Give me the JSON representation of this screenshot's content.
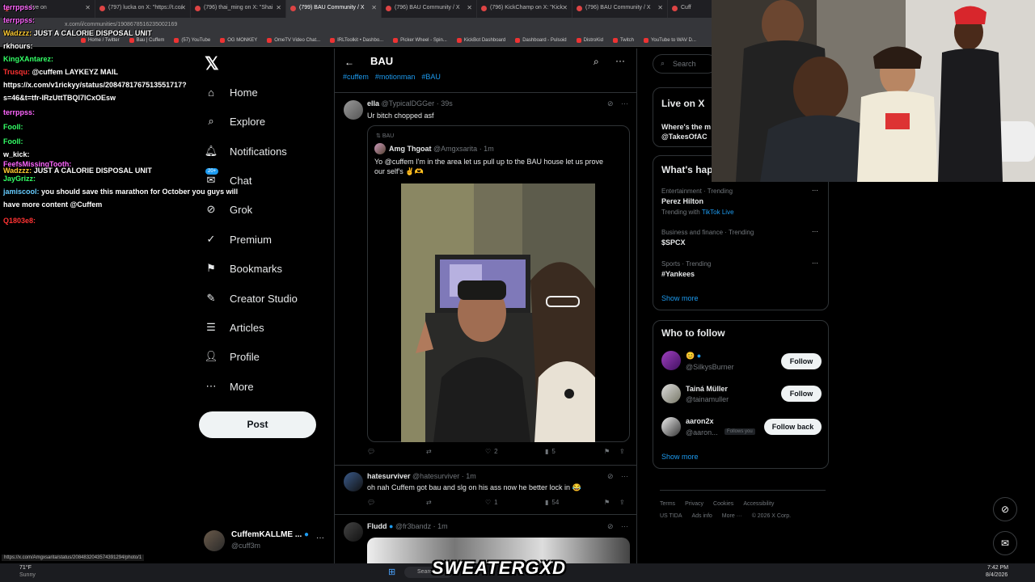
{
  "browser": {
    "tabs": [
      {
        "label": "Watch live on"
      },
      {
        "label": "(797) lucka on X: \"https://t.co/"
      },
      {
        "label": "(796) thai_ming on X: \"Shai"
      },
      {
        "label": "(799) BAU Community / X"
      },
      {
        "label": "(796) BAU Community / X"
      },
      {
        "label": "(796) KickChamp on X: \"Kick"
      },
      {
        "label": "(796) BAU Community / X"
      },
      {
        "label": "Cuff"
      }
    ],
    "url": "x.com/i/communities/1908678516235002169",
    "bookmarks": [
      "Home / Twitter",
      "Bau | Cuffem",
      "(57) YouTube",
      "OG MONKEY",
      "OmeTV Video Chat...",
      "IRLToolkit • Dashbo...",
      "Picker Wheel - Spin...",
      "KickBot Dashboard",
      "Dashboard - Pulsoid",
      "DistroKid",
      "Twitch",
      "YouTube to WAV D..."
    ]
  },
  "nav": {
    "items": [
      "Home",
      "Explore",
      "Notifications",
      "Chat",
      "Grok",
      "Premium",
      "Bookmarks",
      "Creator Studio",
      "Articles",
      "Profile",
      "More"
    ],
    "chat_badge": "20+",
    "post_label": "Post",
    "account_name": "CuffemKALLME ...",
    "account_handle": "@cuff3m"
  },
  "header": {
    "title": "BAU",
    "tags": [
      "#cuffem",
      "#motionman",
      "#BAU"
    ]
  },
  "tweets": [
    {
      "name": "ella",
      "handle": "@TypicalDGGer",
      "time": "· 39s",
      "text": "Ur bitch chopped asf",
      "quote": {
        "community": "BAU",
        "name": "Amg Thgoat",
        "handle": "@Amgxsarita",
        "time": "· 1m",
        "text_1": "Yo @cuffem I'm in the area let us pull up to the BAU house let us prove",
        "text_2": "our self's ✌️🫶"
      },
      "likes": "2",
      "views": "5"
    },
    {
      "name": "hatesurviver",
      "handle": "@hatesurviver",
      "time": "· 1m",
      "text": "oh nah Cuffem got bau and slg on his ass now he better lock in 😂",
      "likes": "1",
      "views": "54"
    },
    {
      "name": "Fludd",
      "handle": "@fr3bandz",
      "time": "· 1m"
    }
  ],
  "right": {
    "search_placeholder": "Search",
    "live_title": "Live on X",
    "live_text": "Where's the m",
    "live_handle": "@TakesOfAC",
    "happening_title": "What's hap",
    "trends": [
      {
        "category": "Entertainment · Trending",
        "name": "Perez Hilton",
        "extra_prefix": "Trending with",
        "extra_link": "TikTok Live"
      },
      {
        "category": "Business and finance · Trending",
        "name": "$SPCX"
      },
      {
        "category": "Sports · Trending",
        "name": "#Yankees"
      }
    ],
    "show_more": "Show more",
    "who_title": "Who to follow",
    "follow": [
      {
        "name": "😊",
        "handle": "@SilkysBurner",
        "button": "Follow"
      },
      {
        "name": "Tainá Müller",
        "handle": "@tainamuller",
        "button": "Follow"
      },
      {
        "name": "aaron2x",
        "handle": "@aaron...",
        "badge": "Follows you",
        "button": "Follow back"
      }
    ],
    "footer_1": [
      "Terms",
      "Privacy",
      "Cookies",
      "Accessibility"
    ],
    "footer_2": [
      "US TIDA",
      "Ads info",
      "More ···",
      "© 2026 X Corp."
    ]
  },
  "chat": [
    {
      "user": "terrppss:",
      "color": "#ff66ff",
      "msg": ""
    },
    {
      "user": "terrppss:",
      "color": "#ff66ff",
      "msg": ""
    },
    {
      "user": "Wadzzz:",
      "color": "#ffcc33",
      "msg": "JUST A CALORIE DISPOSAL UNIT"
    },
    {
      "user": "rkhours:",
      "color": "#ffffff",
      "msg": ""
    },
    {
      "user": "KingXAntarez:",
      "color": "#33ff66",
      "msg": ""
    },
    {
      "user": "Trusqu:",
      "color": "#ff3333",
      "msg": "@cuffem LAYKEYZ MAIL"
    },
    {
      "user": "https://x.com/v1rickyy/status/2084781767513551717?",
      "color": "#ffffff",
      "msg": ""
    },
    {
      "user": "s=46&t=tfr-lRzUttTBQl7lCxOEsw",
      "color": "#ffffff",
      "msg": ""
    },
    {
      "user": "terrppss:",
      "color": "#ff66ff",
      "msg": ""
    },
    {
      "user": "Fooll:",
      "color": "#33ff66",
      "msg": ""
    },
    {
      "user": "Fooll:",
      "color": "#33ff66",
      "msg": ""
    },
    {
      "user": "w_kick:",
      "color": "#ffffff",
      "msg": ""
    },
    {
      "user": "FeefsMissingTooth:",
      "color": "#ff66ff",
      "msg": ""
    },
    {
      "user": "Wadzzz:",
      "color": "#ffcc33",
      "msg": "JUST A CALORIE DISPOSAL UNIT"
    },
    {
      "user": "JayGrizz:",
      "color": "#33ff66",
      "msg": ""
    },
    {
      "user": "jamiscool:",
      "color": "#66ccff",
      "msg": "you should save this marathon for October you guys will"
    },
    {
      "user": "",
      "color": "#ffffff",
      "msg": "have more content @Cuffem"
    },
    {
      "user": "Q1803e8:",
      "color": "#ff3333",
      "msg": ""
    }
  ],
  "status_url": "https://x.com/Amgxsarita/status/2084832043574391294/photo/1",
  "taskbar": {
    "weather_temp": "71°F",
    "weather_text": "Sunny",
    "search": "Search",
    "time": "7:42 PM",
    "date": "8/4/2026",
    "banner": "SWEATERGXD"
  }
}
